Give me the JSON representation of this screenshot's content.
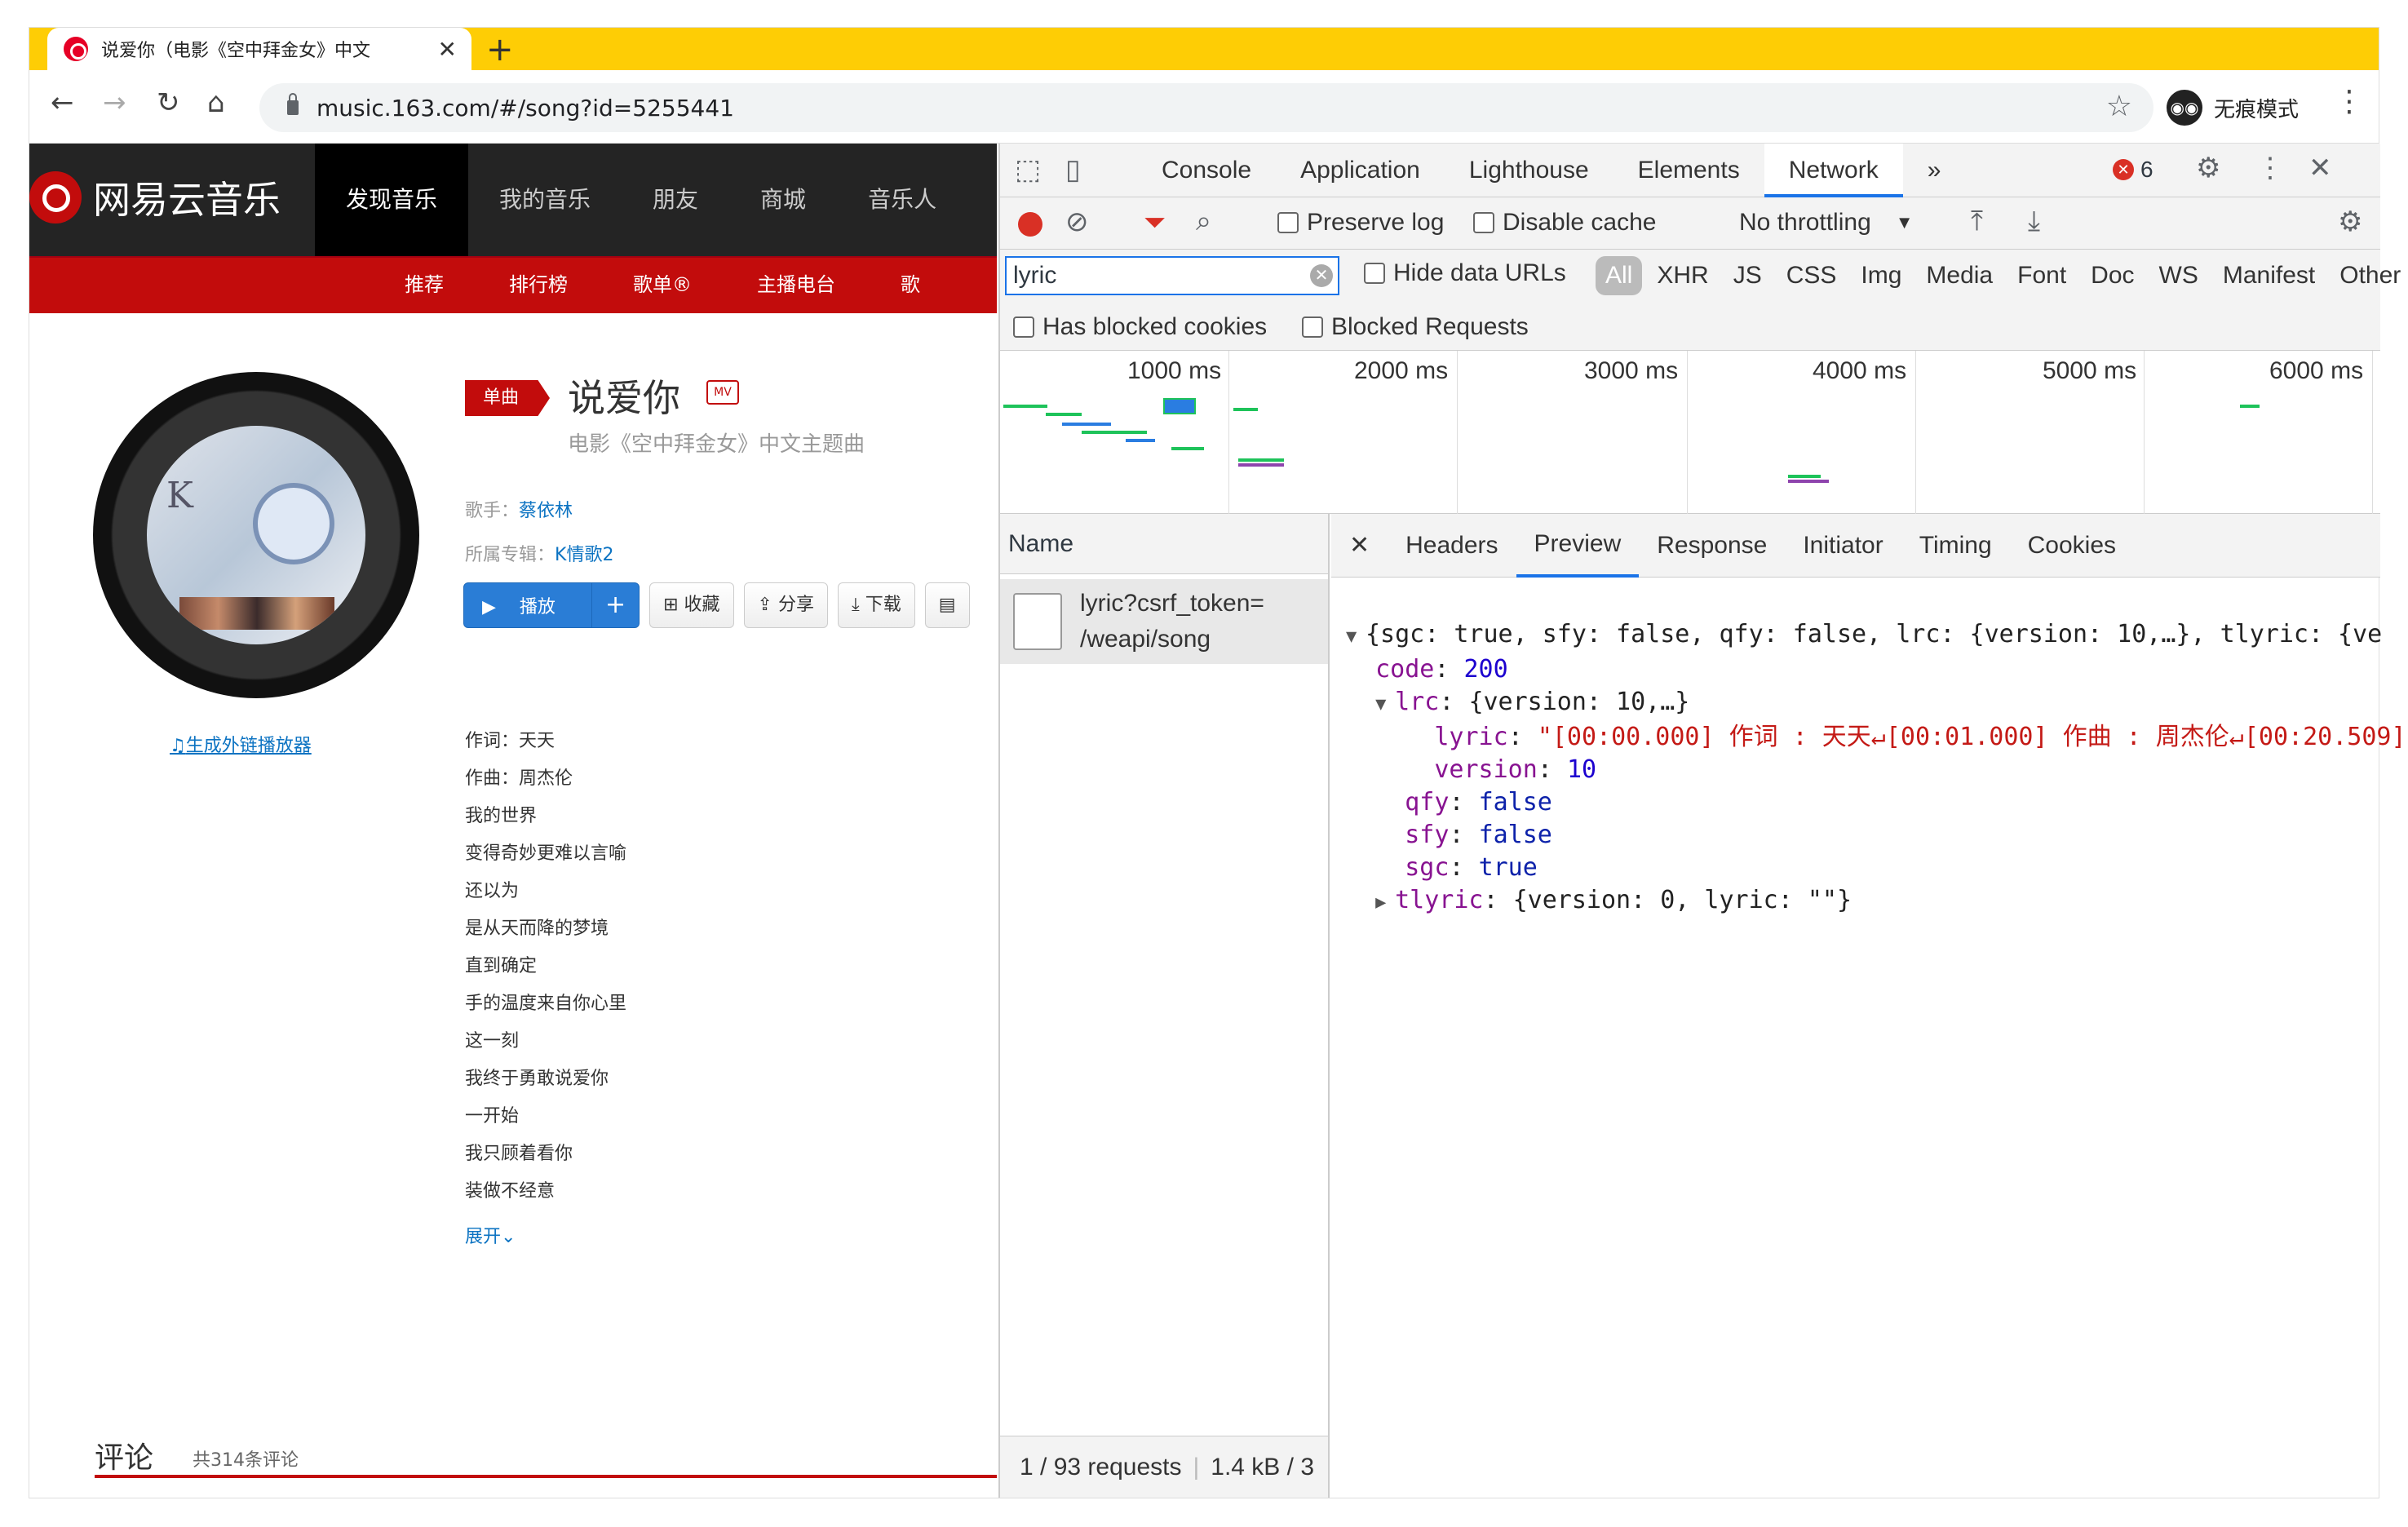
{
  "browser": {
    "tab_title": "说爱你（电影《空中拜金女》中文",
    "url": "music.163.com/#/song?id=5255441",
    "incognito_label": "无痕模式"
  },
  "site": {
    "brand": "网易云音乐",
    "top_nav": [
      "发现音乐",
      "我的音乐",
      "朋友",
      "商城",
      "音乐人"
    ],
    "sub_nav": [
      "推荐",
      "排行榜",
      "歌单®",
      "主播电台",
      "歌"
    ],
    "badge": "单曲",
    "song_title": "说爱你",
    "mv_label": "MV",
    "subtitle": "电影《空中拜金女》中文主题曲",
    "singer_label": "歌手：",
    "singer": "蔡依林",
    "album_label": "所属专辑：",
    "album": "K情歌2",
    "buttons": {
      "play": "播放",
      "add": "+",
      "collect": "收藏",
      "share": "分享",
      "download": "下载"
    },
    "ext_link": "生成外链播放器",
    "lyrics": [
      "作词：天天",
      "作曲：周杰伦",
      "我的世界",
      "变得奇妙更难以言喻",
      "还以为",
      "是从天而降的梦境",
      "直到确定",
      "手的温度来自你心里",
      "这一刻",
      "我终于勇敢说爱你",
      "一开始",
      "我只顾着看你",
      "装做不经意"
    ],
    "expand": "展开",
    "comments_title": "评论",
    "comments_count": "共314条评论"
  },
  "devtools": {
    "tabs": [
      "Console",
      "Application",
      "Lighthouse",
      "Elements",
      "Network"
    ],
    "error_count": "6",
    "toolbar": {
      "preserve_log": "Preserve log",
      "disable_cache": "Disable cache",
      "throttling": "No throttling"
    },
    "filter_value": "lyric",
    "hide_data_urls": "Hide data URLs",
    "types": [
      "All",
      "XHR",
      "JS",
      "CSS",
      "Img",
      "Media",
      "Font",
      "Doc",
      "WS",
      "Manifest",
      "Other"
    ],
    "has_blocked_cookies": "Has blocked cookies",
    "blocked_requests": "Blocked Requests",
    "timeline_ticks": [
      "1000 ms",
      "2000 ms",
      "3000 ms",
      "4000 ms",
      "5000 ms",
      "6000 ms"
    ],
    "name_header": "Name",
    "request_line1": "lyric?csrf_token=",
    "request_line2": "/weapi/song",
    "status": "1 / 93 requests",
    "size": "1.4 kB / 3",
    "detail_tabs": [
      "Headers",
      "Preview",
      "Response",
      "Initiator",
      "Timing",
      "Cookies"
    ],
    "preview": {
      "summary": "{sgc: true, sfy: false, qfy: false, lrc: {version: 10,…}, tlyric: {ve",
      "code_key": "code",
      "code_val": "200",
      "lrc_key": "lrc",
      "lrc_summary": "{version: 10,…}",
      "lyric_key": "lyric",
      "lyric_val": "\"[00:00.000] 作词 : 天天↵[00:01.000] 作曲 : 周杰伦↵[00:20.509]",
      "version_key": "version",
      "version_val": "10",
      "qfy_key": "qfy",
      "qfy_val": "false",
      "sfy_key": "sfy",
      "sfy_val": "false",
      "sgc_key": "sgc",
      "sgc_val": "true",
      "tlyric_key": "tlyric",
      "tlyric_summary": "{version: 0, lyric: \"\"}"
    }
  }
}
